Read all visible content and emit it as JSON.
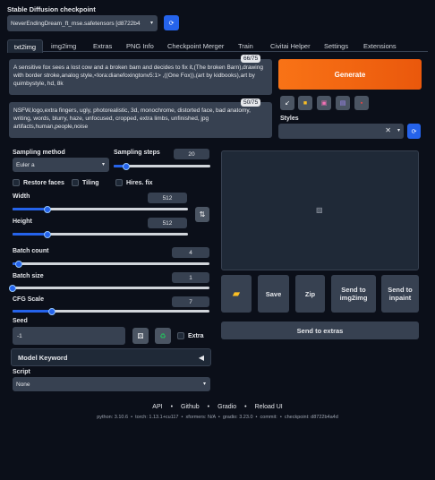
{
  "checkpoint": {
    "label": "Stable Diffusion checkpoint",
    "value": "NeverEndingDream_ft_mse.safetensors [d8722b4"
  },
  "tabs": [
    {
      "label": "txt2img"
    },
    {
      "label": "img2img"
    },
    {
      "label": "Extras"
    },
    {
      "label": "PNG Info"
    },
    {
      "label": "Checkpoint Merger"
    },
    {
      "label": "Train"
    },
    {
      "label": "Civitai Helper"
    },
    {
      "label": "Settings"
    },
    {
      "label": "Extensions"
    }
  ],
  "prompt": {
    "text": "A sensitive fox sees a lost cow and a broken barn and decides to fix it,(The broken Barn),drawing with border stroke,analog style,<lora:dianefoxingtonv5:1> ,((One Fox)),(art by kidbooks),art by quimbystyle, hd, 8k",
    "counter": "66/75"
  },
  "negative_prompt": {
    "text": "NSFW,logo,extra fingers, ugly, photorealistic, 3d, monochrome, distorted face, bad anatomy, writing, words, blurry, haze, unfocused, cropped, extra limbs, unfinished, jpg artifacts,human,people,noise",
    "counter": "50/75"
  },
  "generate_label": "Generate",
  "styles_label": "Styles",
  "sampling": {
    "method_label": "Sampling method",
    "method_value": "Euler a",
    "steps_label": "Sampling steps",
    "steps_value": "20",
    "steps_fraction": 0.13
  },
  "checks": {
    "restore_faces": "Restore faces",
    "tiling": "Tiling",
    "hires": "Hires. fix"
  },
  "width": {
    "label": "Width",
    "value": "512",
    "fraction": 0.2
  },
  "height": {
    "label": "Height",
    "value": "512",
    "fraction": 0.2
  },
  "batch_count": {
    "label": "Batch count",
    "value": "4",
    "fraction": 0.03
  },
  "batch_size": {
    "label": "Batch size",
    "value": "1",
    "fraction": 0.0
  },
  "cfg": {
    "label": "CFG Scale",
    "value": "7",
    "fraction": 0.2
  },
  "seed": {
    "label": "Seed",
    "value": "-1",
    "extra_label": "Extra"
  },
  "model_keyword": {
    "label": "Model Keyword"
  },
  "script": {
    "label": "Script",
    "value": "None"
  },
  "output_buttons": {
    "save": "Save",
    "zip": "Zip",
    "send_img2img": "Send to img2img",
    "send_inpaint": "Send to inpaint",
    "send_extras": "Send to extras"
  },
  "footer": {
    "links": [
      "API",
      "Github",
      "Gradio",
      "Reload UI"
    ],
    "separator": "•",
    "info": "python: 3.10.6  •  torch: 1.13.1+cu117  •  xformers: N/A  •  gradio: 3.23.0  •  commit:  •  checkpoint: d8722b4a4d"
  },
  "colors": {
    "background": "#0b0f19",
    "generate": "#f97316",
    "accent": "#2563eb"
  }
}
